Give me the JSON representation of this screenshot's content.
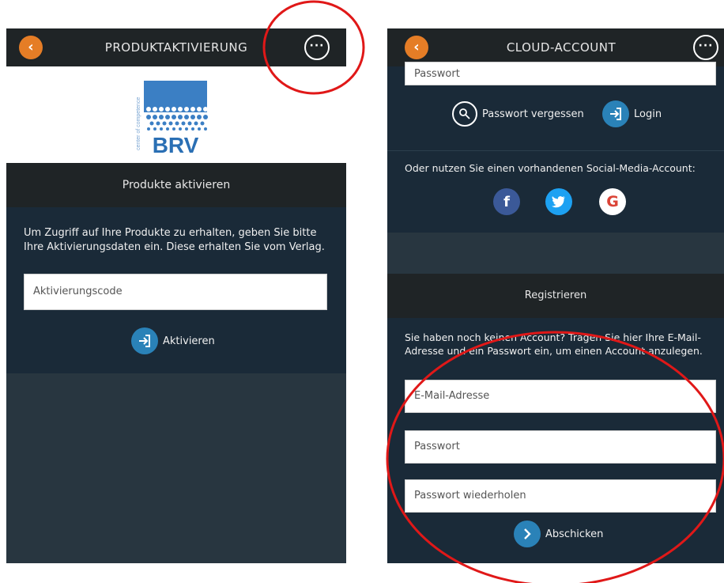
{
  "left_screen": {
    "header": {
      "back_icon": "chevron-left",
      "title": "PRODUKTAKTIVIERUNG",
      "more_icon": "ellipsis"
    },
    "logo": {
      "brand": "BRV",
      "tagline": "center of competence"
    },
    "section_title": "Produkte aktivieren",
    "description": "Um Zugriff auf Ihre Produkte zu erhalten, geben Sie bitte Ihre Aktivierungsdaten ein. Diese erhalten Sie vom Verlag.",
    "activation_code_placeholder": "Aktivierungscode",
    "activate_label": "Aktivieren"
  },
  "right_screen": {
    "header": {
      "back_icon": "chevron-left",
      "title": "CLOUD-ACCOUNT",
      "more_icon": "ellipsis"
    },
    "password_placeholder": "Passwort",
    "forgot_password_label": "Passwort vergessen",
    "login_label": "Login",
    "social_text": "Oder nutzen Sie einen vorhandenen Social-Media-Account:",
    "social": {
      "facebook": "f",
      "twitter": "twitter-bird",
      "google": "G"
    },
    "register_title": "Registrieren",
    "register_text": "Sie haben noch keinen Account? Tragen Sie hier Ihre E-Mail-Adresse und ein Passwort ein, um einen Account anzulegen.",
    "email_placeholder": "E-Mail-Adresse",
    "reg_password_placeholder": "Passwort",
    "reg_password_repeat_placeholder": "Passwort wiederholen",
    "submit_label": "Abschicken"
  },
  "colors": {
    "accent_orange": "#e57d26",
    "action_blue": "#2a82b8",
    "annotation_red": "#e01818",
    "header_dark": "#1f2426",
    "panel_navy": "#1a2a38"
  }
}
